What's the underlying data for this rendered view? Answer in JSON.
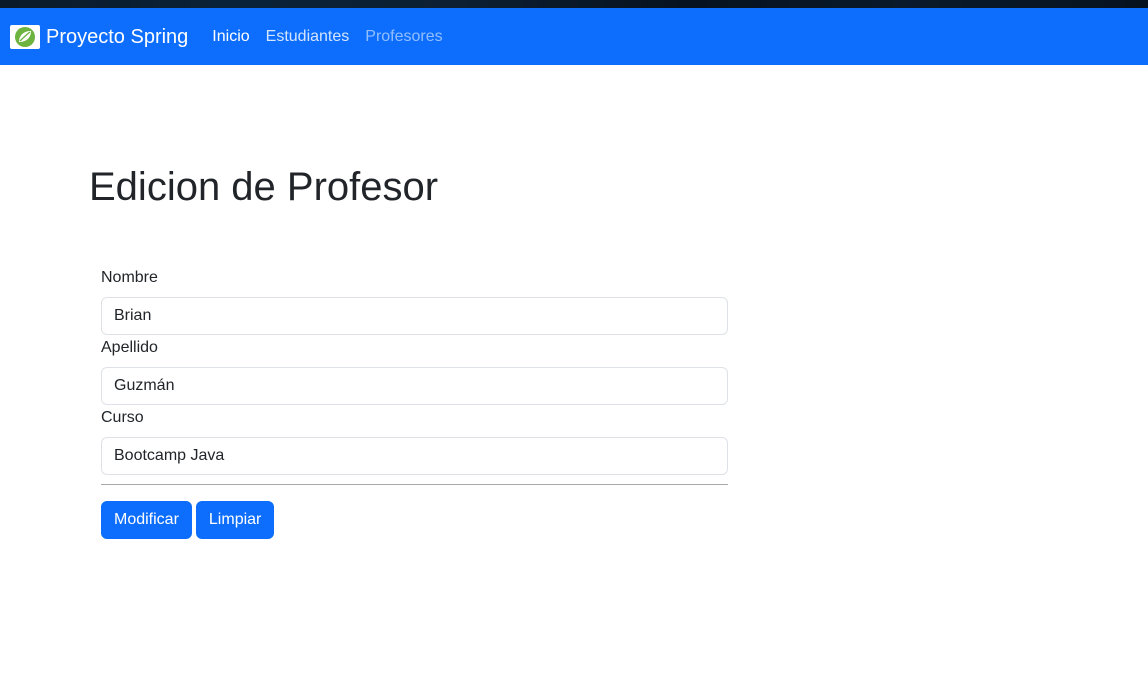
{
  "navbar": {
    "brand": "Proyecto Spring",
    "logo_icon": "spring-leaf-icon",
    "links": [
      {
        "label": "Inicio"
      },
      {
        "label": "Estudiantes"
      },
      {
        "label": "Profesores"
      }
    ],
    "color": "#0d6efd"
  },
  "main": {
    "title": "Edicion de Profesor",
    "fields": [
      {
        "label": "Nombre",
        "value": "Brian"
      },
      {
        "label": "Apellido",
        "value": "Guzmán"
      },
      {
        "label": "Curso",
        "value": "Bootcamp Java"
      }
    ],
    "buttons": {
      "modify": "Modificar",
      "clear": "Limpiar"
    }
  }
}
